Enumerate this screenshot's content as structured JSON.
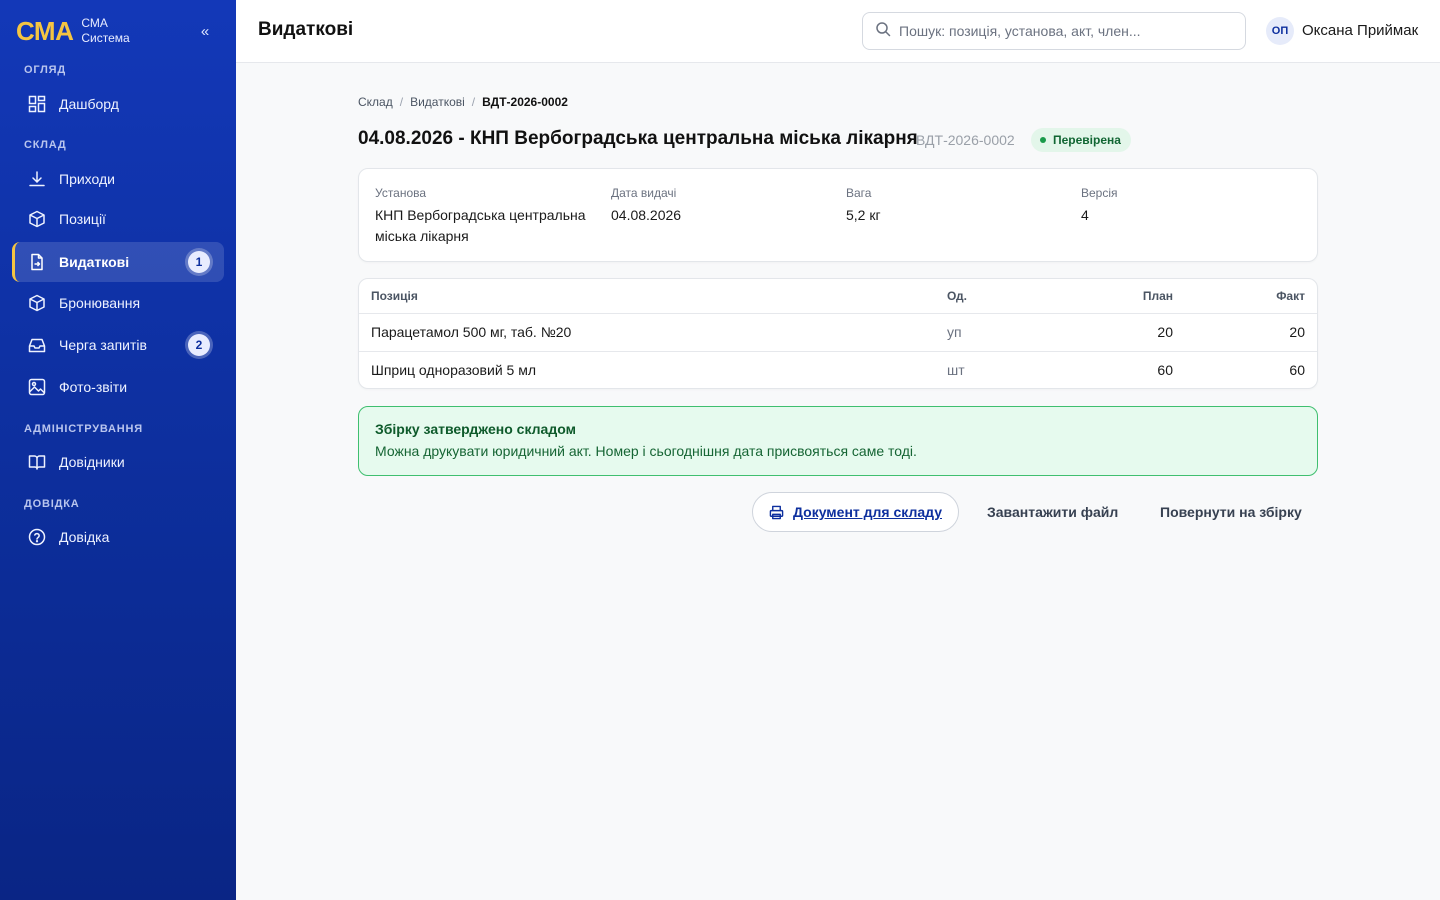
{
  "sidebar": {
    "logo": "СМА",
    "brand_line1": "СМА",
    "brand_line2": "Система",
    "collapse": "«",
    "sections": {
      "overview": "ОГЛЯД",
      "warehouse": "СКЛАД",
      "admin": "АДМІНІСТРУВАННЯ",
      "help": "ДОВІДКА"
    },
    "items": [
      {
        "label": "Дашборд",
        "icon": "dashboard-icon"
      },
      {
        "label": "Приходи",
        "icon": "download-icon"
      },
      {
        "label": "Позиції",
        "icon": "box-icon"
      },
      {
        "label": "Видаткові",
        "icon": "document-icon",
        "badge": "1",
        "active": true
      },
      {
        "label": "Бронювання",
        "icon": "box-icon"
      },
      {
        "label": "Черга запитів",
        "icon": "inbox-icon",
        "badge": "2"
      },
      {
        "label": "Фото-звіти",
        "icon": "image-icon"
      },
      {
        "label": "Довідники",
        "icon": "book-icon"
      },
      {
        "label": "Довідка",
        "icon": "help-circle-icon"
      }
    ]
  },
  "header": {
    "title": "Видаткові",
    "search_placeholder": "Пошук: позиція, установа, акт, член...",
    "user_initials": "ОП",
    "user_name": "Оксана Приймак"
  },
  "breadcrumb": [
    "Склад",
    "Видаткові",
    "ВДТ-2026-0002"
  ],
  "document": {
    "title": "04.08.2026 - КНП Вербоградська центральна міська лікарня",
    "code": "ВДТ-2026-0002",
    "status": "Перевірена",
    "status_color": "#1a9a4a",
    "fields": [
      {
        "label": "Установа",
        "value": "КНП Вербоградська центральна міська лікарня"
      },
      {
        "label": "Дата видачі",
        "value": "04.08.2026"
      },
      {
        "label": "Вага",
        "value": "5,2 кг"
      },
      {
        "label": "Версія",
        "value": "4"
      }
    ]
  },
  "table": {
    "columns": [
      "Позиція",
      "Од.",
      "План",
      "Факт"
    ],
    "rows": [
      [
        "Парацетамол 500 мг, таб. №20",
        "уп",
        "20",
        "20"
      ],
      [
        "Шприц одноразовий 5 мл",
        "шт",
        "60",
        "60"
      ]
    ]
  },
  "alert": {
    "title": "Збірку затверджено складом",
    "text": "Можна друкувати юридичний акт. Номер і сьогоднішня дата присвояться саме тоді."
  },
  "actions": {
    "print_doc": "Документ для складу",
    "download": "Завантажити файл",
    "return": "Повернути на збірку"
  },
  "colors": {
    "sidebar_bg": "#0d2f9e",
    "accent": "#f5c542",
    "success": "#3fbf6f"
  }
}
